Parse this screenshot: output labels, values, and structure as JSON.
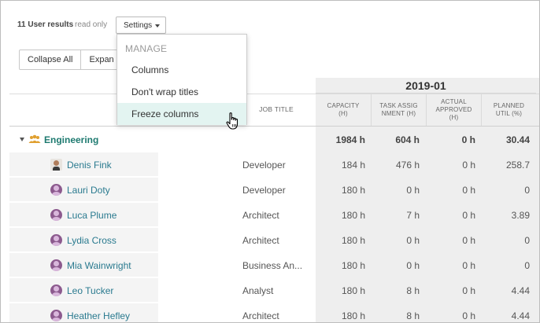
{
  "toolbar": {
    "results_count": "11 User results",
    "readonly_label": "read only",
    "settings_label": "Settings",
    "collapse_all_label": "Collapse All",
    "expand_all_label": "Expan"
  },
  "settings_menu": {
    "section_label": "MANAGE",
    "items": [
      {
        "label": "Columns"
      },
      {
        "label": "Don't wrap titles"
      },
      {
        "label": "Freeze columns",
        "hovered": true
      }
    ]
  },
  "grid": {
    "job_title_header": "JOB TITLE",
    "month": "2019-01",
    "columns": [
      {
        "label": "CAPACITY (H)"
      },
      {
        "label": "TASK ASSIGNMENT (H)"
      },
      {
        "label": "ACTUAL APPROVED (H)"
      },
      {
        "label": "PLANNED UTIL (%)"
      }
    ],
    "group": {
      "name": "Engineering",
      "capacity": "1984 h",
      "task_assignment": "604 h",
      "actual_approved": "0 h",
      "planned_util": "30.44"
    },
    "rows": [
      {
        "name": "Denis Fink",
        "avatar": "photo",
        "job_title": "Developer",
        "capacity": "184 h",
        "task_assignment": "476 h",
        "actual_approved": "0 h",
        "planned_util": "258.7"
      },
      {
        "name": "Lauri Doty",
        "avatar": "default",
        "job_title": "Developer",
        "capacity": "180 h",
        "task_assignment": "0 h",
        "actual_approved": "0 h",
        "planned_util": "0"
      },
      {
        "name": "Luca Plume",
        "avatar": "default",
        "job_title": "Architect",
        "capacity": "180 h",
        "task_assignment": "7 h",
        "actual_approved": "0 h",
        "planned_util": "3.89"
      },
      {
        "name": "Lydia Cross",
        "avatar": "default",
        "job_title": "Architect",
        "capacity": "180 h",
        "task_assignment": "0 h",
        "actual_approved": "0 h",
        "planned_util": "0"
      },
      {
        "name": "Mia Wainwright",
        "avatar": "default",
        "job_title": "Business An...",
        "capacity": "180 h",
        "task_assignment": "0 h",
        "actual_approved": "0 h",
        "planned_util": "0"
      },
      {
        "name": "Leo Tucker",
        "avatar": "default",
        "job_title": "Analyst",
        "capacity": "180 h",
        "task_assignment": "8 h",
        "actual_approved": "0 h",
        "planned_util": "4.44"
      },
      {
        "name": "Heather Hefley",
        "avatar": "default",
        "job_title": "Architect",
        "capacity": "180 h",
        "task_assignment": "8 h",
        "actual_approved": "0 h",
        "planned_util": "4.44"
      }
    ]
  },
  "colors": {
    "link": "#2a7a8f",
    "group": "#1e7a70",
    "hover_bg": "#e3f4f1",
    "month_band": "#eeeeee"
  },
  "icons": {
    "group": "people-group-icon",
    "expand": "triangle-down-icon",
    "cursor": "hand-pointer-icon"
  }
}
